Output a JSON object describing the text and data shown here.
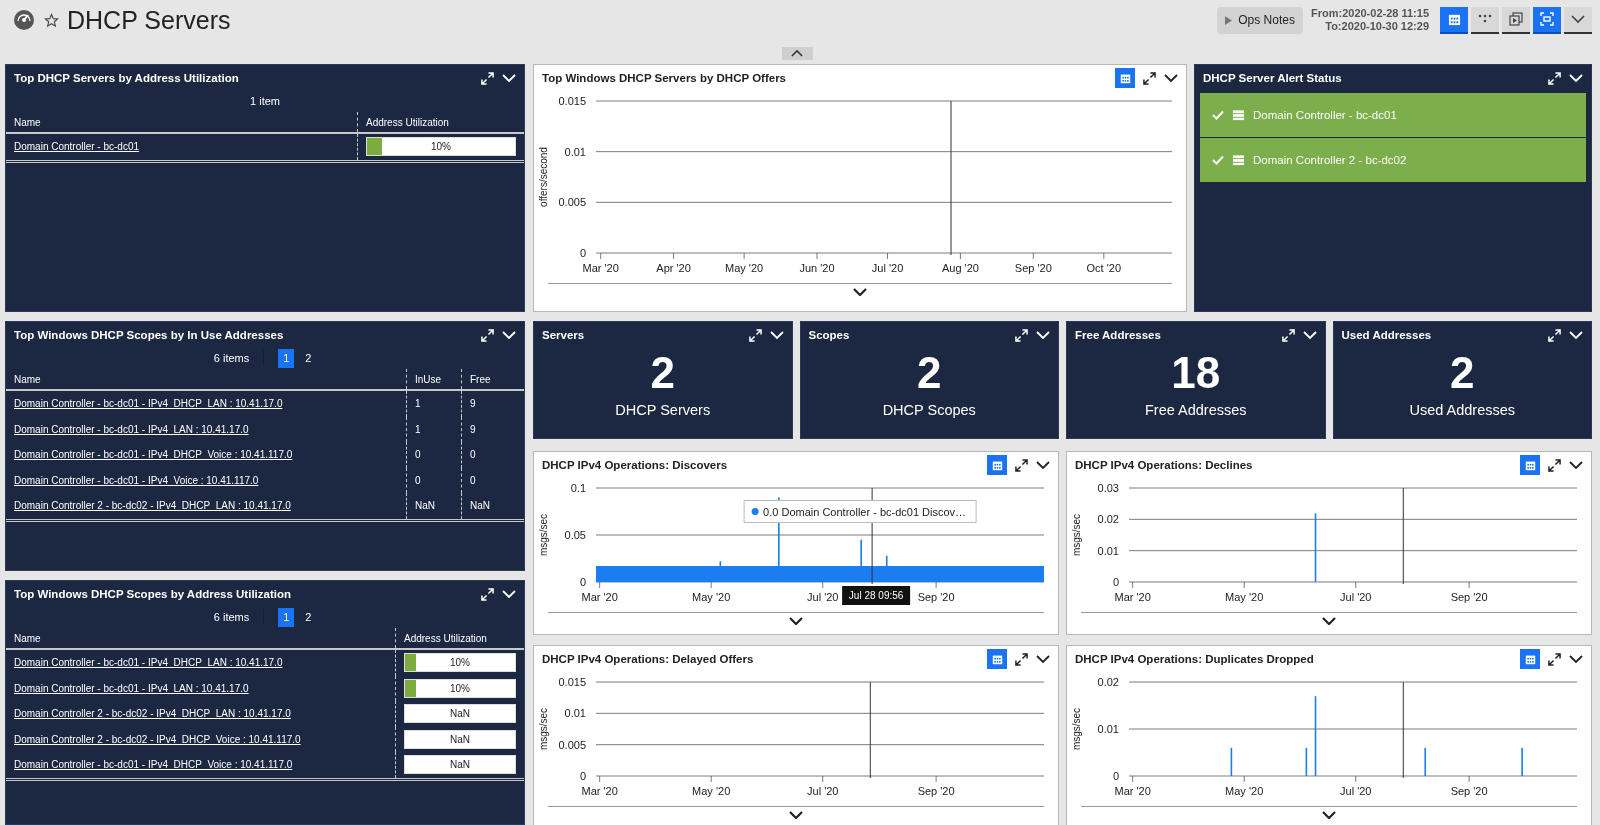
{
  "header": {
    "title": "DHCP Servers",
    "ops_notes": "Ops Notes",
    "from": "From:2020-02-28 11:15",
    "to": "To:2020-10-30 12:29",
    "tools": [
      {
        "kind": "calendar",
        "active": true
      },
      {
        "kind": "more",
        "active": false
      },
      {
        "kind": "copy",
        "active": false
      },
      {
        "kind": "fullscreen",
        "active": true
      },
      {
        "kind": "menu",
        "active": false
      }
    ]
  },
  "table_panels": [
    {
      "title": "Top DHCP Servers by Address Utilization",
      "count": "1 item",
      "columns": [
        {
          "label": "Name",
          "kind": "link"
        },
        {
          "label": "Address Utilization",
          "kind": "bar"
        }
      ],
      "rows": [
        {
          "cells": [
            "Domain Controller - bc-dc01",
            {
              "text": "10%",
              "level": 0.1
            }
          ]
        }
      ]
    },
    {
      "title": "Top Windows DHCP Scopes by In Use Addresses",
      "count": "6 items",
      "pages": [
        {
          "label": "1",
          "selected": true
        },
        {
          "label": "2",
          "selected": false
        }
      ],
      "columns": [
        {
          "label": "Name",
          "kind": "link"
        },
        {
          "label": "InUse",
          "kind": "text"
        },
        {
          "label": "Free",
          "kind": "text"
        }
      ],
      "rows": [
        {
          "cells": [
            "Domain Controller - bc-dc01 - IPv4_DHCP_LAN : 10.41.17.0",
            "1",
            "9"
          ]
        },
        {
          "cells": [
            "Domain Controller - bc-dc01 - IPv4_LAN : 10.41.17.0",
            "1",
            "9"
          ]
        },
        {
          "cells": [
            "Domain Controller - bc-dc01 - IPv4_DHCP_Voice : 10.41.117.0",
            "0",
            "0"
          ]
        },
        {
          "cells": [
            "Domain Controller - bc-dc01 - IPv4_Voice : 10.41.117.0",
            "0",
            "0"
          ]
        },
        {
          "cells": [
            "Domain Controller 2 - bc-dc02 - IPv4_DHCP_LAN : 10.41.17.0",
            "NaN",
            "NaN"
          ]
        }
      ]
    },
    {
      "title": "Top Windows DHCP Scopes by Address Utilization",
      "count": "6 items",
      "pages": [
        {
          "label": "1",
          "selected": true
        },
        {
          "label": "2",
          "selected": false
        }
      ],
      "columns": [
        {
          "label": "Name",
          "kind": "link"
        },
        {
          "label": "Address Utilization",
          "kind": "bar"
        }
      ],
      "rows": [
        {
          "cells": [
            "Domain Controller - bc-dc01 - IPv4_DHCP_LAN : 10.41.17.0",
            {
              "text": "10%",
              "level": 0.1
            }
          ]
        },
        {
          "cells": [
            "Domain Controller - bc-dc01 - IPv4_LAN : 10.41.17.0",
            {
              "text": "10%",
              "level": 0.1
            }
          ]
        },
        {
          "cells": [
            "Domain Controller 2 - bc-dc02 - IPv4_DHCP_LAN : 10.41.17.0",
            {
              "text": "NaN"
            }
          ]
        },
        {
          "cells": [
            "Domain Controller 2 - bc-dc02 - IPv4_DHCP_Voice : 10.41.117.0",
            {
              "text": "NaN"
            }
          ]
        },
        {
          "cells": [
            "Domain Controller - bc-dc01 - IPv4_DHCP_Voice : 10.41.117.0",
            {
              "text": "NaN"
            }
          ]
        }
      ]
    }
  ],
  "offers_chart": {
    "title": "Top Windows DHCP Servers by DHCP Offers",
    "ylabel": "offers/second",
    "y_ticks": [
      "0.015",
      "0.01",
      "0.005",
      "0"
    ],
    "x_ticks": [
      "Mar '20",
      "Apr '20",
      "May '20",
      "Jun '20",
      "Jul '20",
      "Aug '20",
      "Sep '20",
      "Oct '20"
    ]
  },
  "alert_status": {
    "title": "DHCP Server Alert Status",
    "items": [
      {
        "name": "Domain Controller - bc-dc01",
        "color": "#7dae4c"
      },
      {
        "name": "Domain Controller 2 - bc-dc02",
        "color": "#7dae4c"
      }
    ]
  },
  "stat_cards": [
    {
      "title": "Servers",
      "value": "2",
      "label": "DHCP Servers"
    },
    {
      "title": "Scopes",
      "value": "2",
      "label": "DHCP Scopes"
    },
    {
      "title": "Free Addresses",
      "value": "18",
      "label": "Free Addresses"
    },
    {
      "title": "Used Addresses",
      "value": "2",
      "label": "Used Addresses"
    }
  ],
  "operation_charts": [
    {
      "title": "DHCP IPv4 Operations: Discovers",
      "ylabel": "msgs/sec",
      "y_ticks": [
        "0.1",
        "0.05",
        "0"
      ],
      "x_ticks": [
        "Mar '20",
        "May '20",
        "Jul '20",
        "Sep '20"
      ],
      "tooltip": "0.0 Domain Controller - bc-dc01 Discov…",
      "cursor_time": "Jul 28 09:56"
    },
    {
      "title": "DHCP IPv4 Operations: Declines",
      "ylabel": "msgs/sec",
      "y_ticks": [
        "0.03",
        "0.02",
        "0.01",
        "0"
      ],
      "x_ticks": [
        "Mar '20",
        "May '20",
        "Jul '20",
        "Sep '20"
      ]
    },
    {
      "title": "DHCP IPv4 Operations: Delayed Offers",
      "ylabel": "msgs/sec",
      "y_ticks": [
        "0.015",
        "0.01",
        "0.005",
        "0"
      ],
      "x_ticks": [
        "Mar '20",
        "May '20",
        "Jul '20",
        "Sep '20"
      ]
    },
    {
      "title": "DHCP IPv4 Operations: Duplicates Dropped",
      "ylabel": "msgs/sec",
      "y_ticks": [
        "0.02",
        "0.01",
        "0"
      ],
      "x_ticks": [
        "Mar '20",
        "May '20",
        "Jul '20",
        "Sep '20"
      ]
    }
  ]
}
